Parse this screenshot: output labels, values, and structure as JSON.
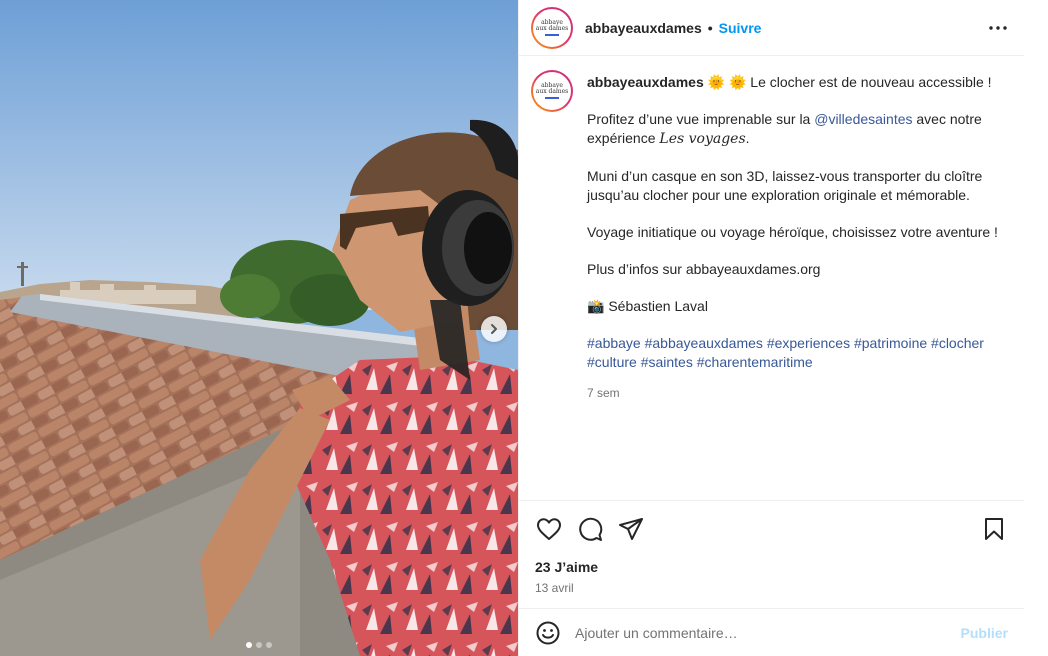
{
  "post": {
    "username": "abbayeauxdames",
    "follow_label": "Suivre",
    "header_separator": "•",
    "avatar_text": [
      "abbaye",
      "aux dames"
    ],
    "caption": {
      "first_line": "Le clocher est de nouveau accessible !",
      "sun_emojis": "🌞 🌞",
      "p1_before": "Profitez d’une vue imprenable sur la ",
      "p1_mention": "@villedesaintes",
      "p1_middle": " avec notre expérience ",
      "p1_styled": "Les voyages",
      "p1_end": ".",
      "p2": "Muni d’un casque en son 3D, laissez-vous transporter du cloître jusqu’au clocher pour une exploration originale et mémorable.",
      "p3": "Voyage initiatique ou voyage héroïque, choisissez votre aventure !",
      "p4": "Plus d’infos sur abbayeauxdames.org",
      "credit_emoji": "📸",
      "credit": "Sébastien Laval",
      "hashtags": [
        "#abbaye",
        "#abbayeauxdames",
        "#experiences",
        "#patrimoine",
        "#clocher",
        "#culture",
        "#saintes",
        "#charentemaritime"
      ],
      "age": "7 sem"
    },
    "likes": "23 J’aime",
    "date": "13 avril",
    "comment": {
      "placeholder": "Ajouter un commentaire…",
      "value": "",
      "publish_label": "Publier"
    },
    "carousel": {
      "current": 1,
      "total": 3
    }
  },
  "icons": {
    "more": "more-options-icon",
    "like": "heart-icon",
    "comment": "comment-icon",
    "share": "paper-plane-icon",
    "save": "bookmark-icon",
    "emoji": "smiley-icon",
    "next": "chevron-right-icon"
  },
  "colors": {
    "link": "#385898",
    "follow": "#0095f6",
    "publish_disabled": "#b2dffc",
    "secondary_text": "#737373",
    "border": "#efefef"
  }
}
